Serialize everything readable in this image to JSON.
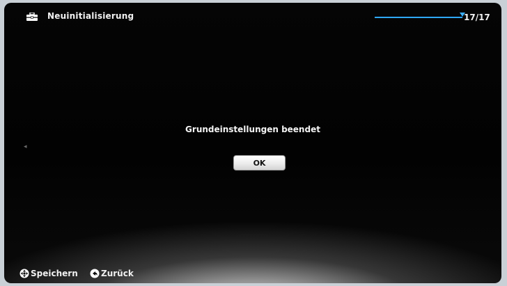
{
  "header": {
    "title": "Neuinitialisierung",
    "title_icon": "toolbox-icon",
    "page_counter": "17/17",
    "progress": {
      "current": 17,
      "total": 17,
      "color": "#2ea8ff"
    }
  },
  "dialog": {
    "message": "Grundeinstellungen beendet",
    "ok_label": "OK"
  },
  "footer": {
    "hints": [
      {
        "icon": "dpad-select-icon",
        "label": "Speichern"
      },
      {
        "icon": "back-icon",
        "label": "Zurück"
      }
    ]
  },
  "side_indicator": "◂"
}
